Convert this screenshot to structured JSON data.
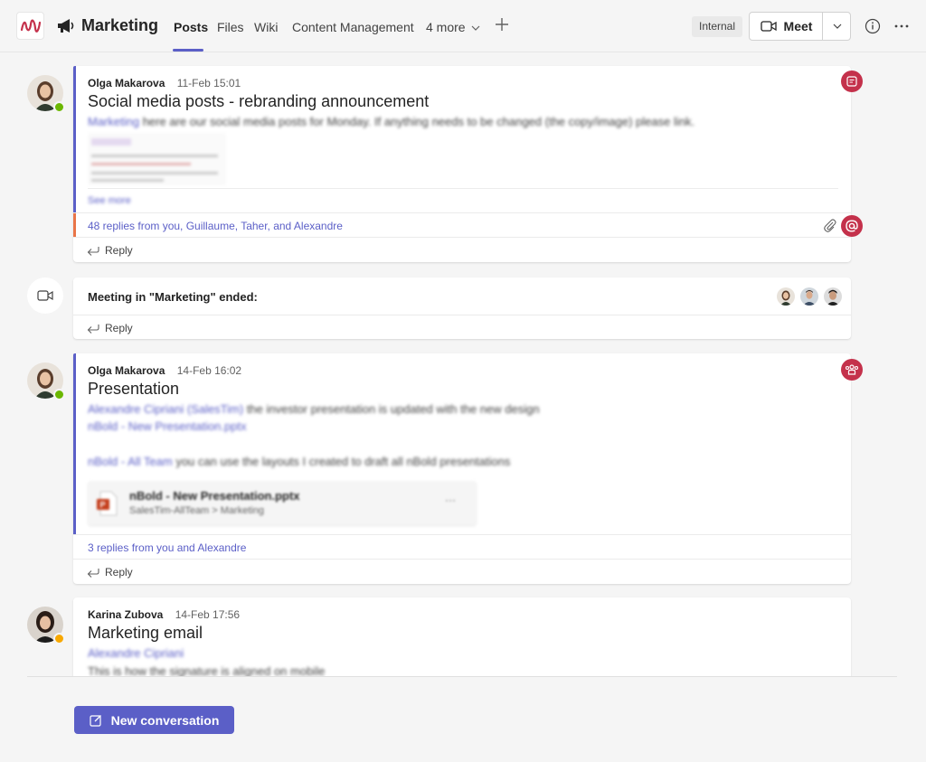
{
  "header": {
    "channel_title": "Marketing",
    "tabs": [
      "Posts",
      "Files",
      "Wiki",
      "Content Management",
      "4 more"
    ],
    "internal_label": "Internal",
    "meet_label": "Meet"
  },
  "posts": [
    {
      "author": "Olga Makarova",
      "time": "11-Feb 15:01",
      "title": "Social media posts - rebranding announcement",
      "mention": "Marketing",
      "body": "here are our social media posts for Monday. If anything needs to be changed (the copy/image) please link.",
      "see_more": "See more",
      "replies": "48 replies from you, Guillaume, Taher, and Alexandre",
      "reply_label": "Reply"
    },
    {
      "meeting_text": "Meeting in \"Marketing\" ended:",
      "reply_label": "Reply"
    },
    {
      "author": "Olga Makarova",
      "time": "14-Feb 16:02",
      "title": "Presentation",
      "line1_mention": "Alexandre Cipriani (SalesTim)",
      "line1_text": "the investor presentation is updated with the new design",
      "line2_link": "nBold - New Presentation.pptx",
      "line3_mention": "nBold - All Team",
      "line3_text": "you can use the layouts I created to draft all nBold presentations",
      "file_name": "nBold - New Presentation.pptx",
      "file_path": "SalesTim-AllTeam > Marketing",
      "replies": "3 replies from you and Alexandre",
      "reply_label": "Reply"
    },
    {
      "author": "Karina Zubova",
      "time": "14-Feb 17:56",
      "title": "Marketing email",
      "mention": "Alexandre Cipriani",
      "body": "This is how the signature is aligned on mobile"
    }
  ],
  "new_conversation_label": "New conversation",
  "colors": {
    "accent": "#5b5fc7",
    "alert": "#c4314b",
    "available": "#6bb700",
    "away": "#f8a800"
  }
}
